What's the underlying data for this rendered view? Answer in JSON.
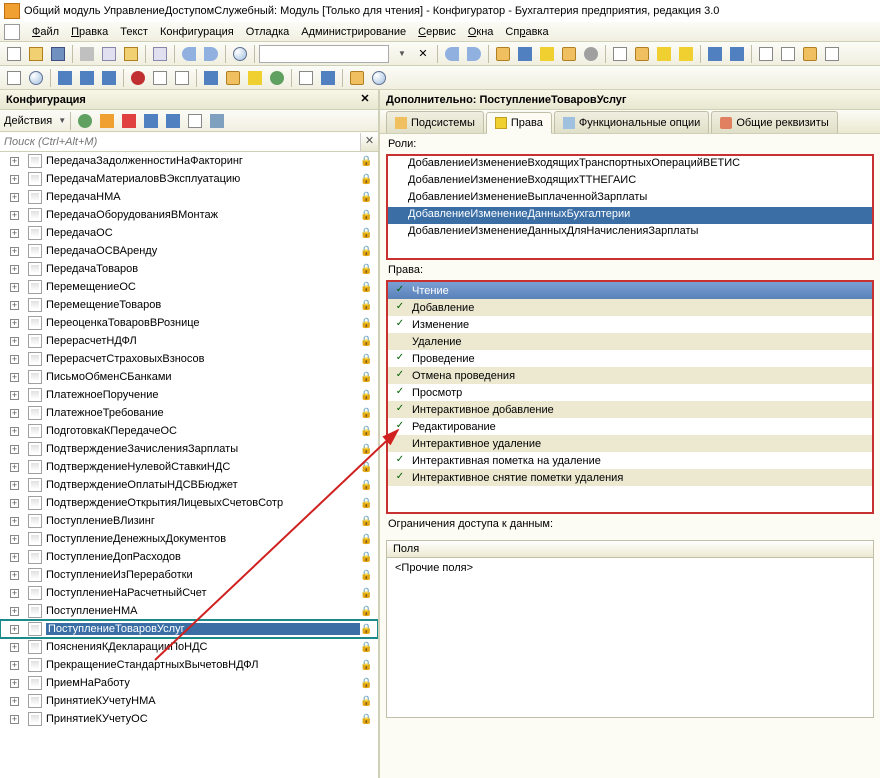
{
  "window_title": "Общий модуль УправлениеДоступомСлужебный: Модуль [Только для чтения] - Конфигуратор - Бухгалтерия предприятия, редакция 3.0",
  "menu": {
    "file": "Файл",
    "edit": "Правка",
    "text": "Текст",
    "config": "Конфигурация",
    "debug": "Отладка",
    "admin": "Администрирование",
    "service": "Сервис",
    "windows": "Окна",
    "help": "Справка"
  },
  "left": {
    "title": "Конфигурация",
    "actions": "Действия",
    "search_placeholder": "Поиск (Ctrl+Alt+M)"
  },
  "tree": [
    "ПередачаЗадолженностиНаФакторинг",
    "ПередачаМатериаловВЭксплуатацию",
    "ПередачаНМА",
    "ПередачаОборудованияВМонтаж",
    "ПередачаОС",
    "ПередачаОСВАренду",
    "ПередачаТоваров",
    "ПеремещениеОС",
    "ПеремещениеТоваров",
    "ПереоценкаТоваровВРознице",
    "ПерерасчетНДФЛ",
    "ПерерасчетСтраховыхВзносов",
    "ПисьмоОбменСБанками",
    "ПлатежноеПоручение",
    "ПлатежноеТребование",
    "ПодготовкаКПередачеОС",
    "ПодтверждениеЗачисленияЗарплаты",
    "ПодтверждениеНулевойСтавкиНДС",
    "ПодтверждениеОплатыНДСВБюджет",
    "ПодтверждениеОткрытияЛицевыхСчетовСотр",
    "ПоступлениеВЛизинг",
    "ПоступлениеДенежныхДокументов",
    "ПоступлениеДопРасходов",
    "ПоступлениеИзПереработки",
    "ПоступлениеНаРасчетныйСчет",
    "ПоступлениеНМА",
    "ПоступлениеТоваровУслуг",
    "ПоясненияКДекларацииПоНДС",
    "ПрекращениеСтандартныхВычетовНДФЛ",
    "ПриемНаРаботу",
    "ПринятиеКУчетуНМА",
    "ПринятиеКУчетуОС"
  ],
  "tree_selected_index": 26,
  "right": {
    "title": "Дополнительно: ПоступлениеТоваровУслуг",
    "tabs": {
      "subsystems": "Подсистемы",
      "rights": "Права",
      "functional": "Функциональные опции",
      "common": "Общие реквизиты"
    },
    "roles_label": "Роли:",
    "roles": [
      "ДобавлениеИзменениеВходящихТранспортныхОперацийВЕТИС",
      "ДобавлениеИзменениеВходящихТТНЕГАИС",
      "ДобавлениеИзменениеВыплаченнойЗарплаты",
      "ДобавлениеИзменениеДанныхБухгалтерии",
      "ДобавлениеИзменениеДанныхДляНачисленияЗарплаты"
    ],
    "role_selected_index": 3,
    "rights_label": "Права:",
    "rights_list": [
      {
        "label": "Чтение",
        "checked": true,
        "selected": true
      },
      {
        "label": "Добавление",
        "checked": true,
        "alt": true
      },
      {
        "label": "Изменение",
        "checked": true
      },
      {
        "label": "Удаление",
        "checked": false,
        "alt": true
      },
      {
        "label": "Проведение",
        "checked": true
      },
      {
        "label": "Отмена проведения",
        "checked": true,
        "alt": true
      },
      {
        "label": "Просмотр",
        "checked": true
      },
      {
        "label": "Интерактивное добавление",
        "checked": true,
        "alt": true
      },
      {
        "label": "Редактирование",
        "checked": true
      },
      {
        "label": "Интерактивное удаление",
        "checked": false,
        "alt": true
      },
      {
        "label": "Интерактивная пометка на удаление",
        "checked": true
      },
      {
        "label": "Интерактивное снятие пометки удаления",
        "checked": true,
        "alt": true
      }
    ],
    "constraints_label": "Ограничения доступа к данным:",
    "constraints_header": "Поля",
    "constraints_body": "<Прочие поля>"
  }
}
